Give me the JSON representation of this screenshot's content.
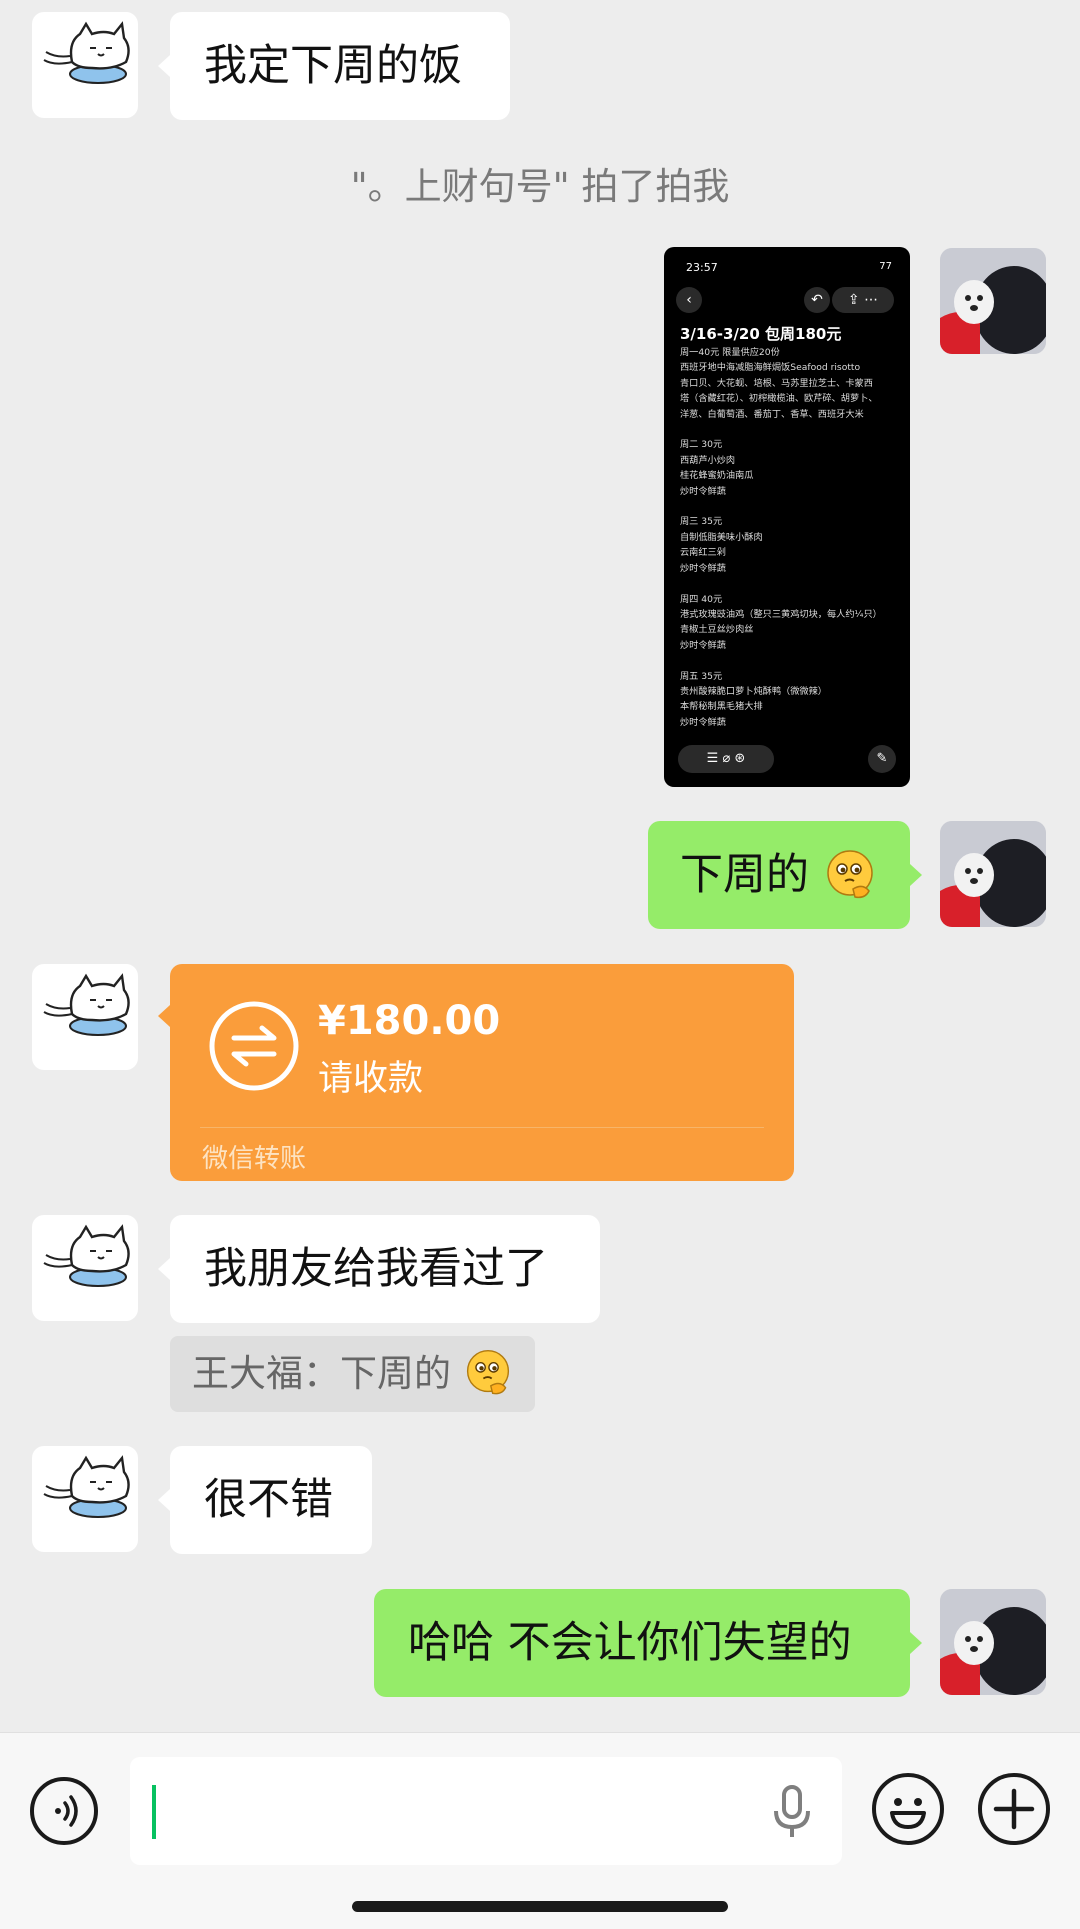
{
  "messages": {
    "m1_text": "我定下周的饭",
    "system_note": "\"。上财句号\" 拍了拍我",
    "m3_text": "下周的",
    "transfer": {
      "amount": "¥180.00",
      "status": "请收款",
      "footer": "微信转账"
    },
    "m5_text": "我朋友给我看过了",
    "quote_text": "王大福：下周的",
    "m6_text": "很不错",
    "m7_text": "哈哈 不会让你们失望的"
  },
  "screenshot": {
    "status_time": "23:57",
    "status_right": "77",
    "title": "3/16-3/20 包周180元",
    "body": "周一40元 限量供应20份\n西班牙地中海减脂海鲜焗饭Seafood risotto\n青口贝、大花蚬、培根、马苏里拉芝士、卡蒙西\n塔（含藏红花）、初榨橄榄油、欧芹碎、胡萝卜、\n洋葱、白葡萄酒、番茄丁、香草、西班牙大米\n\n周二 30元\n西葫芦小炒肉\n桂花蜂蜜奶油南瓜\n炒时令鲜蔬\n\n周三 35元\n自制低脂美味小酥肉\n云南红三剁\n炒时令鲜蔬\n\n周四 40元\n港式玫瑰豉油鸡（整只三黄鸡切块，每人约¼只）\n青椒土豆丝炒肉丝\n炒时令鲜蔬\n\n周五 35元\n贵州酸辣脆口萝卜炖酥鸭（微微辣）\n本帮秘制黑毛猪大排\n炒时令鲜蔬"
  },
  "colors": {
    "background": "#ededed",
    "green_bubble": "#95ec69",
    "transfer_orange": "#fa9d3b",
    "cursor": "#07c160"
  },
  "icons": [
    "cat-avatar-icon",
    "dog-photo-avatar",
    "transfer-arrows-icon",
    "voice-icon",
    "microphone-icon",
    "emoji-face-icon",
    "plus-icon",
    "thinking-emoji"
  ]
}
